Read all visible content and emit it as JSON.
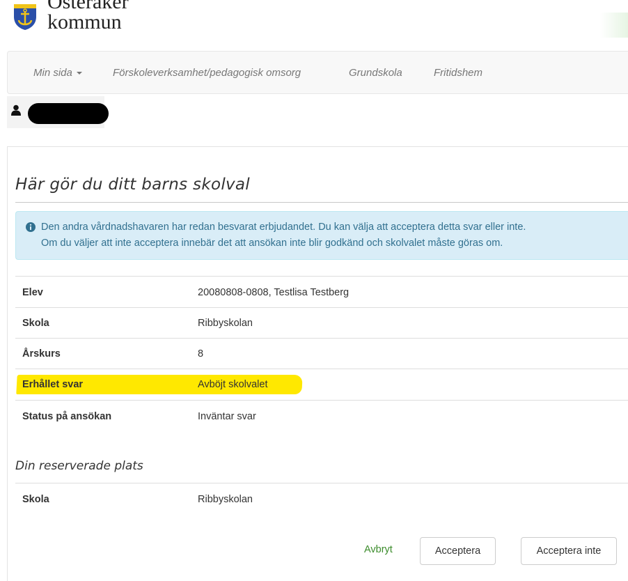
{
  "header": {
    "logo_top_text": "Österåker",
    "logo_name": "kommun",
    "colors": {
      "shield_blue": "#2a4fa8",
      "shield_gold": "#f0c419"
    }
  },
  "nav": {
    "items": [
      {
        "label": "Min sida",
        "has_dropdown": true
      },
      {
        "label": "Förskoleverksamhet/pedagogisk omsorg"
      },
      {
        "label": "Grundskola"
      },
      {
        "label": "Fritidshem"
      }
    ]
  },
  "user": {
    "icon": "user-icon",
    "name_redacted": true
  },
  "main": {
    "title": "Här gör du ditt barns skolval",
    "alert": {
      "icon": "info-icon",
      "line1": "Den andra vårdnadshavaren har redan besvarat erbjudandet. Du kan välja att acceptera detta svar eller inte.",
      "line2": "Om du väljer att inte acceptera innebär det att ansökan inte blir godkänd och skolvalet måste göras om."
    },
    "details": [
      {
        "label": "Elev",
        "value": "20080808-0808, Testlisa Testberg"
      },
      {
        "label": "Skola",
        "value": "Ribbyskolan"
      },
      {
        "label": "Årskurs",
        "value": "8"
      },
      {
        "label": "Erhållet svar",
        "value": "Avböjt skolvalet",
        "highlighted": true
      },
      {
        "label": "Status på ansökan",
        "value": "Inväntar svar"
      }
    ],
    "reserved": {
      "title": "Din reserverade plats",
      "rows": [
        {
          "label": "Skola",
          "value": "Ribbyskolan"
        }
      ]
    },
    "actions": {
      "cancel": "Avbryt",
      "accept": "Acceptera",
      "decline": "Acceptera inte"
    }
  },
  "colors": {
    "alert_bg": "#d9edf7",
    "alert_text": "#31708f",
    "highlight": "#ffe800",
    "link_green": "#3c8c2c"
  }
}
